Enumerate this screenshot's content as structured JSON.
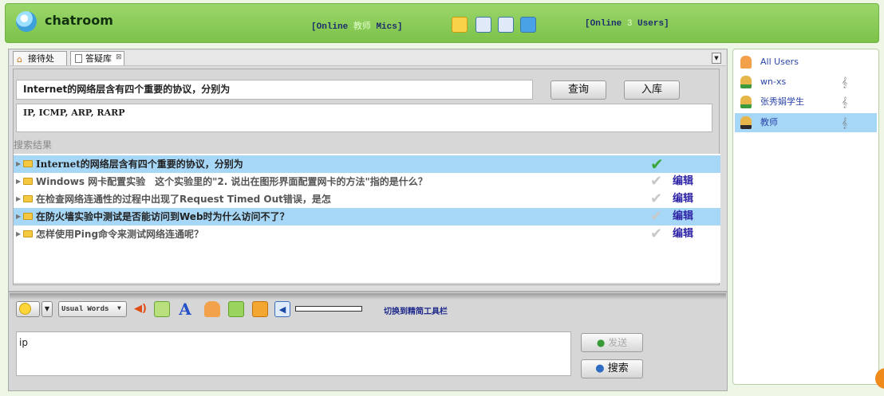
{
  "header": {
    "app_title": "chatroom",
    "mics": {
      "prefix": "[Online",
      "value": "教师",
      "suffix": "Mics]"
    },
    "users_online": {
      "prefix": "[Online",
      "value": "3",
      "suffix": "Users]"
    },
    "tool_icons": [
      "edit-icon",
      "trash-icon",
      "calendar-icon",
      "chat-bubble-icon"
    ]
  },
  "tabs": [
    {
      "label": "接待处",
      "icon": "home-icon"
    },
    {
      "label": "答疑库",
      "icon": "document-icon",
      "close": "⊠"
    }
  ],
  "search": {
    "query_value": "Internet的网络层含有四个重要的协议，分别为",
    "query_button": "查询",
    "save_button": "入库",
    "answer": "IP, ICMP, ARP, RARP"
  },
  "results": {
    "label": "搜索结果",
    "edit_label": "编辑",
    "rows": [
      {
        "text": "Internet的网络层含有四个重要的协议，分别为",
        "selected": true,
        "checked": true,
        "editable": false
      },
      {
        "text": "Windows 网卡配置实验　这个实验里的\"2. 说出在图形界面配置网卡的方法\"指的是什么？",
        "selected": false,
        "checked": false,
        "editable": true
      },
      {
        "text": "在检查网络连通性的过程中出现了Request Timed Out错误，是怎",
        "selected": false,
        "checked": false,
        "editable": true
      },
      {
        "text": "在防火墙实验中测试是否能访问到Web时为什么访问不了？",
        "selected": true,
        "checked": false,
        "editable": true
      },
      {
        "text": "怎样使用Ping命令来测试网络连通呢？",
        "selected": false,
        "checked": false,
        "editable": true
      }
    ]
  },
  "toolbar": {
    "usual_words": "Usual Words",
    "switch_label": "切换到精简工具栏",
    "icons": [
      "smiley-icon",
      "speaker-icon",
      "edit-icon",
      "font-icon",
      "user-icon",
      "image-icon",
      "download-icon",
      "volume-icon"
    ]
  },
  "message": {
    "value": "ip",
    "send_label": "发送",
    "search_label": "搜索"
  },
  "users": {
    "all_label": "All Users",
    "items": [
      {
        "name": "wn-xs",
        "selected": false
      },
      {
        "name": "张秀娟学生",
        "selected": false
      },
      {
        "name": "教师",
        "selected": true
      }
    ]
  },
  "colors": {
    "header": "#84c852",
    "selection": "#a7d7f7",
    "edit": "#2f25a6",
    "check": "#39a839"
  }
}
